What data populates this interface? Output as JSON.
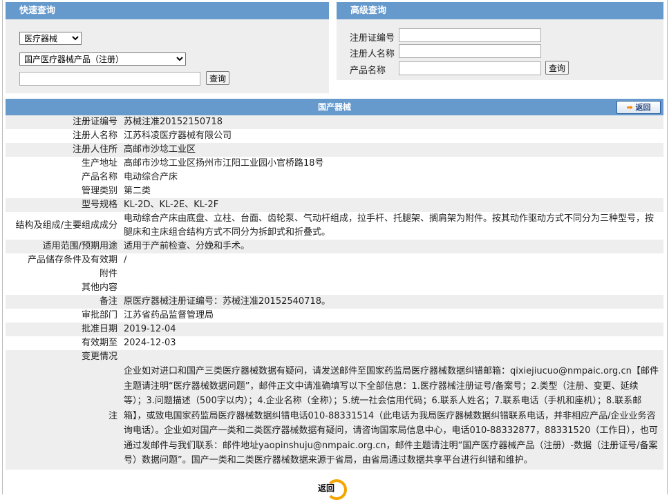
{
  "quick": {
    "title": "快速查询",
    "select1": "医疗器械",
    "select2": "国产医疗器械产品（注册）",
    "search_value": "",
    "button": "查询"
  },
  "advanced": {
    "title": "高级查询",
    "label_cert": "注册证编号",
    "label_registrant": "注册人名称",
    "label_product": "产品名称",
    "button": "查询"
  },
  "detail": {
    "title": "国产器械",
    "back": "返回",
    "rows": [
      {
        "k": "注册证编号",
        "v": "苏械注准20152150718"
      },
      {
        "k": "注册人名称",
        "v": "江苏科凌医疗器械有限公司"
      },
      {
        "k": "注册人住所",
        "v": "高邮市沙埝工业区"
      },
      {
        "k": "生产地址",
        "v": "高邮市沙埝工业区扬州市江阳工业园小官桥路18号"
      },
      {
        "k": "产品名称",
        "v": "电动综合产床"
      },
      {
        "k": "管理类别",
        "v": "第二类"
      },
      {
        "k": "型号规格",
        "v": "KL-2D、KL-2E、KL-2F"
      },
      {
        "k": "结构及组成/主要组成成分",
        "v": "电动综合产床由底盘、立柱、台面、齿轮泵、气动杆组成，拉手杆、托腿架、搁肩架为附件。按其动作驱动方式不同分为三种型号，按腿床和主床组合结构方式不同分为拆卸式和折叠式。"
      },
      {
        "k": "适用范围/预期用途",
        "v": "适用于产前检查、分娩和手术。"
      },
      {
        "k": "产品储存条件及有效期",
        "v": "/"
      },
      {
        "k": "附件",
        "v": ""
      },
      {
        "k": "其他内容",
        "v": ""
      },
      {
        "k": "备注",
        "v": "原医疗器械注册证编号：苏械注准20152540718。"
      },
      {
        "k": "审批部门",
        "v": "江苏省药品监督管理局"
      },
      {
        "k": "批准日期",
        "v": "2019-12-04"
      },
      {
        "k": "有效期至",
        "v": "2024-12-03"
      },
      {
        "k": "变更情况",
        "v": ""
      },
      {
        "k": "注",
        "v": "企业如对进口和国产三类医疗器械数据有疑问，请发送邮件至国家药监局医疗器械数据纠错邮箱：qixiejiucuo@nmpaic.org.cn【邮件主题请注明“医疗器械数据问题”，邮件正文中请准确填写以下全部信息：1.医疗器械注册证号/备案号；2.类型（注册、变更、延续等）；3.问题描述（500字以内）；4.企业名称（全称）；5.统一社会信用代码；6.联系人姓名；7.联系电话（手机和座机）；8.联系邮箱】，或致电国家药监局医疗器械数据纠错电话010-88331514（此电话为我局医疗器械数据纠错联系电话，并非相应产品/企业业务咨询电话）。企业如对国产一类和二类医疗器械数据有疑问，请咨询国家局信息中心，电话010-88332877，88331520（工作日），也可通过发邮件与我们联系：邮件地址yaopinshuju@nmpaic.org.cn，邮件主题请注明“国产医疗器械产品（注册）-数据（注册证号/备案号）数据问题”。国产一类和二类医疗器械数据来源于省局，由省局通过数据共享平台进行纠错和维护。"
      }
    ]
  },
  "footer": {
    "back": "返回"
  }
}
